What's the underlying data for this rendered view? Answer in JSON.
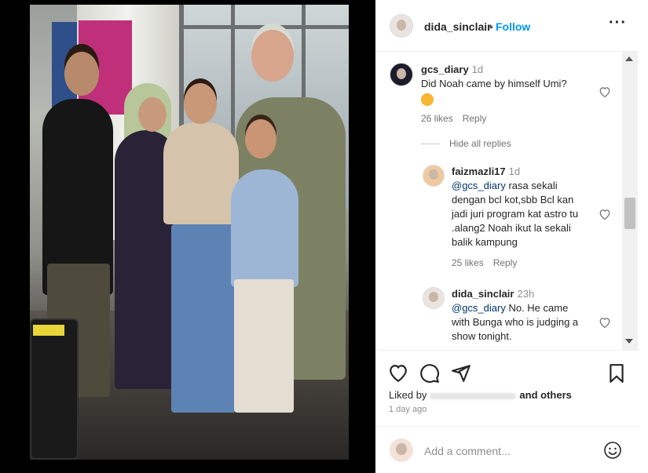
{
  "header": {
    "username": "dida_sinclair",
    "separator": "•",
    "follow_label": "Follow",
    "more_label": "···"
  },
  "comments": [
    {
      "username": "gcs_diary",
      "time": "1d",
      "text": "Did Noah came by himself Umi?",
      "likes": "26 likes",
      "reply_label": "Reply"
    }
  ],
  "hide_replies_label": "Hide all replies",
  "replies": [
    {
      "username": "faizmazli17",
      "time": "1d",
      "mention": "@gcs_diary",
      "line1": " rasa sekali",
      "line2": "dengan bcl kot,sbb Bcl kan",
      "line3": "jadi juri program kat astro tu",
      "line4": ".alang2 Noah ikut la sekali",
      "line5": "balik kampung",
      "likes": "25 likes",
      "reply_label": "Reply"
    },
    {
      "username": "dida_sinclair",
      "time": "23h",
      "mention": "@gcs_diary",
      "line1": " No. He came",
      "line2": "with Bunga who is judging a",
      "line3": "show tonight."
    }
  ],
  "footer": {
    "liked_by": "Liked by",
    "and_others": "and others",
    "date": "1 day ago",
    "add_comment_placeholder": "Add a comment..."
  },
  "icons": [
    "heart-icon",
    "comment-icon",
    "share-icon",
    "bookmark-icon",
    "emoji-icon"
  ],
  "colors": {
    "follow": "#0095f6",
    "mention": "#00376b",
    "muted": "#8e8e8e"
  }
}
